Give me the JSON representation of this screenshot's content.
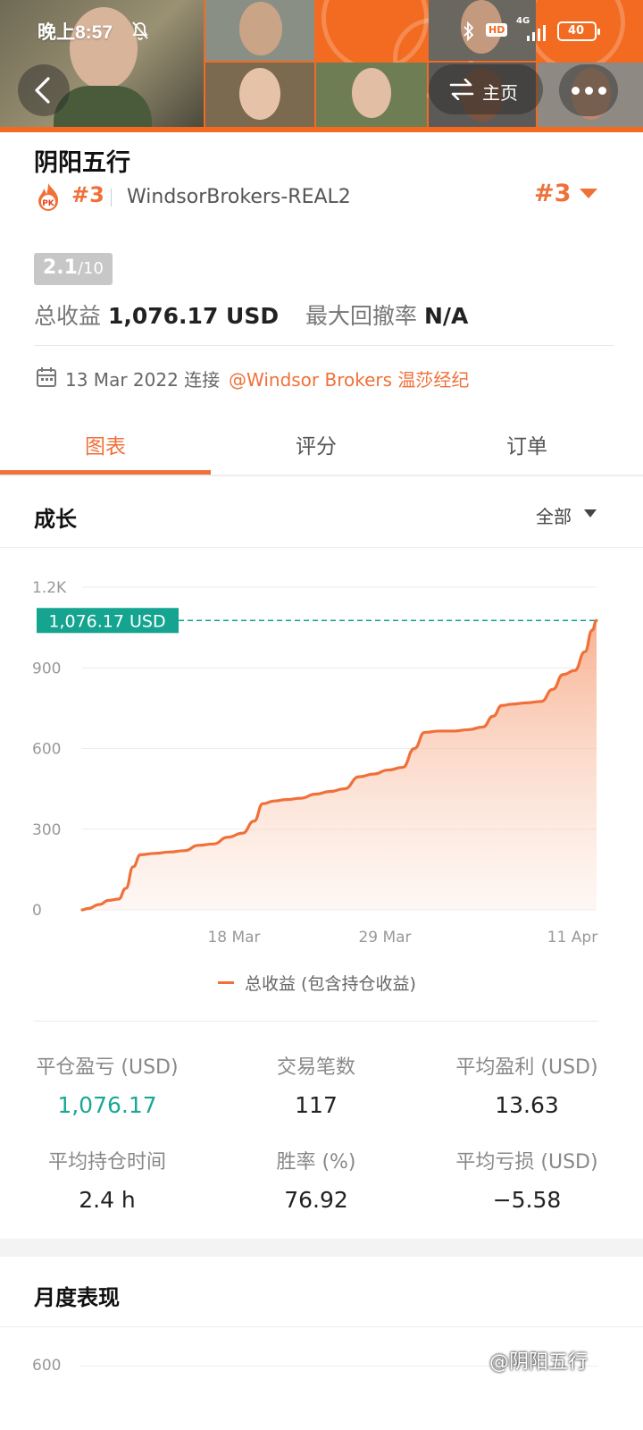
{
  "status_bar": {
    "time": "晚上8:57",
    "network": "4G",
    "hd": "HD",
    "battery": "40"
  },
  "nav": {
    "home_label": "主页"
  },
  "profile": {
    "name": "阴阳五行",
    "rank": "#3",
    "broker_server": "WindsorBrokers-REAL2",
    "rank_right": "#3",
    "score": "2.1",
    "score_max": "/10",
    "total_profit_label": "总收益",
    "total_profit_value": "1,076.17 USD",
    "max_drawdown_label": "最大回撤率",
    "max_drawdown_value": "N/A",
    "connect_date": "13 Mar 2022 连接",
    "broker_link": "@Windsor Brokers 温莎经纪"
  },
  "tabs": [
    {
      "label": "图表"
    },
    {
      "label": "评分"
    },
    {
      "label": "订单"
    }
  ],
  "growth": {
    "title": "成长",
    "filter": "全部"
  },
  "chart_data": {
    "type": "area",
    "title": "",
    "xlabel": "",
    "ylabel": "",
    "ylim": [
      0,
      1200
    ],
    "yticks": [
      "0",
      "300",
      "600",
      "900",
      "1.2K"
    ],
    "yticks_values": [
      0,
      300,
      600,
      900,
      1200
    ],
    "xticks": [
      "18 Mar",
      "29 Mar",
      "11 Apr"
    ],
    "xticks_days": [
      5,
      16,
      29
    ],
    "x_start_day": 0,
    "x_end_day": 30,
    "current_value_label": "1,076.17 USD",
    "current_value": 1076.17,
    "colors": {
      "line": "#f0703a",
      "tag": "#14a48f",
      "dashed": "#1a9e8a"
    },
    "series": [
      {
        "name": "总收益 (包含持仓收益)",
        "points": [
          [
            0,
            0
          ],
          [
            0.4,
            5
          ],
          [
            1.2,
            20
          ],
          [
            1.8,
            35
          ],
          [
            2.5,
            40
          ],
          [
            3.0,
            80
          ],
          [
            3.5,
            160
          ],
          [
            4.0,
            205
          ],
          [
            5.0,
            210
          ],
          [
            6.0,
            215
          ],
          [
            7.0,
            220
          ],
          [
            8.0,
            240
          ],
          [
            9.0,
            245
          ],
          [
            10.0,
            270
          ],
          [
            11.0,
            285
          ],
          [
            11.8,
            330
          ],
          [
            12.4,
            395
          ],
          [
            13.2,
            405
          ],
          [
            14.0,
            410
          ],
          [
            15.0,
            415
          ],
          [
            16.0,
            430
          ],
          [
            17.0,
            440
          ],
          [
            18.0,
            450
          ],
          [
            19.0,
            495
          ],
          [
            20.0,
            505
          ],
          [
            21.0,
            520
          ],
          [
            22.0,
            530
          ],
          [
            22.8,
            600
          ],
          [
            23.5,
            660
          ],
          [
            24.5,
            665
          ],
          [
            25.5,
            665
          ],
          [
            26.5,
            670
          ],
          [
            27.5,
            680
          ],
          [
            28.2,
            720
          ],
          [
            28.8,
            760
          ],
          [
            29.5,
            765
          ],
          [
            30.5,
            770
          ],
          [
            31.5,
            775
          ],
          [
            32.3,
            820
          ],
          [
            33.0,
            875
          ],
          [
            33.8,
            890
          ],
          [
            34.5,
            960
          ],
          [
            35.0,
            1040
          ],
          [
            35.3,
            1076.17
          ]
        ]
      }
    ],
    "legend": "总收益 (包含持仓收益)"
  },
  "stats": [
    {
      "label": "平仓盈亏 (USD)",
      "value": "1,076.17"
    },
    {
      "label": "交易笔数",
      "value": "117"
    },
    {
      "label": "平均盈利 (USD)",
      "value": "13.63"
    },
    {
      "label": "平均持仓时间",
      "value": "2.4 h"
    },
    {
      "label": "胜率 (%)",
      "value": "76.92"
    },
    {
      "label": "平均亏损 (USD)",
      "value": "−5.58"
    }
  ],
  "monthly": {
    "title": "月度表现",
    "ytick_top": "600"
  },
  "watermark": "@阴阳五行"
}
